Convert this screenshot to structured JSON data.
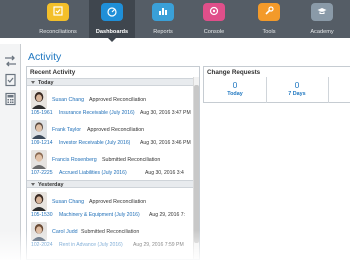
{
  "nav": {
    "items": [
      {
        "label": "Reconciliations",
        "icon": "reconciliations-icon",
        "color": "#f3bf2a"
      },
      {
        "label": "Dashboards",
        "icon": "dashboards-icon",
        "color": "#1f8fd8",
        "active": true
      },
      {
        "label": "Reports",
        "icon": "reports-icon",
        "color": "#3aa0d8"
      },
      {
        "label": "Console",
        "icon": "console-icon",
        "color": "#e04f8a"
      },
      {
        "label": "Tools",
        "icon": "tools-icon",
        "color": "#f39a2a"
      },
      {
        "label": "Academy",
        "icon": "academy-icon",
        "color": "#8a9aa8"
      }
    ]
  },
  "page": {
    "title": "Activity"
  },
  "recent_activity": {
    "title": "Recent Activity",
    "groups": [
      {
        "label": "Today",
        "entries": [
          {
            "name": "Susan Chang",
            "action": "Approved Reconciliation",
            "id": "105-1961",
            "account": "Insurance Receivable (July 2016)",
            "date": "Aug 30, 2016 3:47 PM"
          },
          {
            "name": "Frank Taylor",
            "action": "Approved Reconciliation",
            "id": "109-1214",
            "account": "Investor Receivable (July 2016)",
            "date": "Aug 30, 2016 3:46 PM"
          },
          {
            "name": "Francis Rosenberg",
            "action": "Submitted Reconciliation",
            "id": "107-2225",
            "account": "Accrued Liabilities (July 2016)",
            "date": "Aug 30, 2016 3:4"
          }
        ]
      },
      {
        "label": "Yesterday",
        "entries": [
          {
            "name": "Susan Chang",
            "action": "Approved Reconciliation",
            "id": "105-1530",
            "account": "Machinery & Equipment (July 2016)",
            "date": "Aug 29, 2016 7:"
          },
          {
            "name": "Carol Judd",
            "action": "Submitted Reconciliation",
            "id": "102-2024",
            "account": "Rent in Advance (July 2016)",
            "date": "Aug 29, 2016 7:59 PM"
          }
        ]
      }
    ]
  },
  "change_requests": {
    "title": "Change Requests",
    "stats": [
      {
        "value": "0",
        "label": "Today"
      },
      {
        "value": "0",
        "label": "7 Days"
      },
      {
        "value": "",
        "label": ""
      }
    ]
  },
  "colors": {
    "accent": "#1f77c0",
    "nav_bg": "#555d66"
  }
}
